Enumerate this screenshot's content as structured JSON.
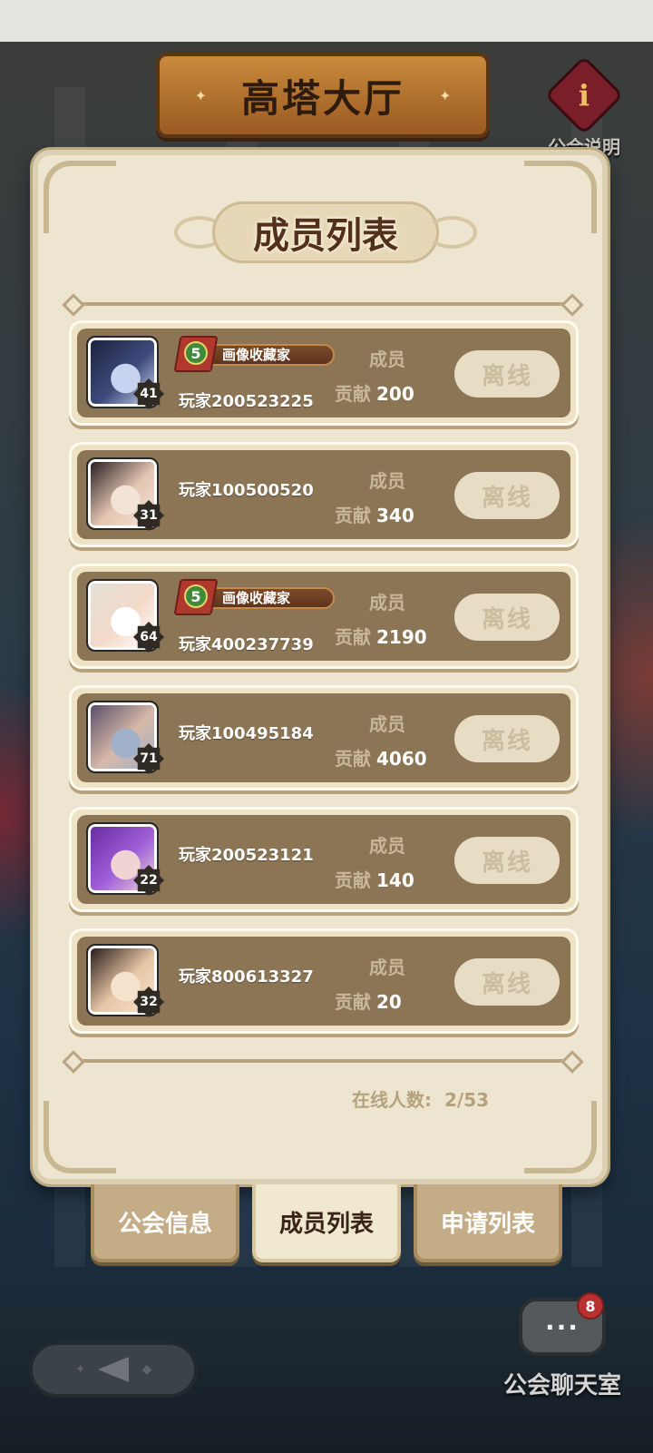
{
  "header": {
    "title": "高塔大厅",
    "guild_info_label": "公会说明",
    "guild_info_icon_glyph": "i"
  },
  "panel": {
    "title": "成员列表",
    "status_label": "离线",
    "members": [
      {
        "name": "玩家200523225",
        "level": "41",
        "role": "成员",
        "contribution_label": "贡献",
        "contribution": "200",
        "title_badge": {
          "rank": "5",
          "text": "画像收藏家"
        },
        "avatar_colors": [
          "#1d2340",
          "#3d4a7a",
          "#c8d4ef"
        ]
      },
      {
        "name": "玩家100500520",
        "level": "31",
        "role": "成员",
        "contribution_label": "贡献",
        "contribution": "340",
        "title_badge": null,
        "avatar_colors": [
          "#2a1f24",
          "#e5c6b2",
          "#f3e3d6"
        ]
      },
      {
        "name": "玩家400237739",
        "level": "64",
        "role": "成员",
        "contribution_label": "贡献",
        "contribution": "2190",
        "title_badge": {
          "rank": "5",
          "text": "画像收藏家"
        },
        "avatar_colors": [
          "#e4e0d8",
          "#f3d9c8",
          "#ffffff"
        ]
      },
      {
        "name": "玩家100495184",
        "level": "71",
        "role": "成员",
        "contribution_label": "贡献",
        "contribution": "4060",
        "title_badge": null,
        "avatar_colors": [
          "#5a4f6a",
          "#d7b9a8",
          "#9fb0c8"
        ]
      },
      {
        "name": "玩家200523121",
        "level": "22",
        "role": "成员",
        "contribution_label": "贡献",
        "contribution": "140",
        "title_badge": null,
        "avatar_colors": [
          "#6a2aa0",
          "#a060d8",
          "#f0d4d4"
        ]
      },
      {
        "name": "玩家800613327",
        "level": "32",
        "role": "成员",
        "contribution_label": "贡献",
        "contribution": "20",
        "title_badge": null,
        "avatar_colors": [
          "#2a1e1a",
          "#e8c6a6",
          "#f5e2cc"
        ]
      }
    ],
    "online_label": "在线人数:",
    "online_value": "2/53"
  },
  "tabs": [
    {
      "label": "公会信息",
      "active": false
    },
    {
      "label": "成员列表",
      "active": true
    },
    {
      "label": "申请列表",
      "active": false
    }
  ],
  "bottom": {
    "chat_label": "公会聊天室",
    "chat_badge": "8",
    "chat_icon_glyph": "···",
    "back_icon": "back-arrow-icon"
  },
  "colors": {
    "panel_bg": "#ede5cf",
    "row_bg": "#8c7554",
    "title_brown": "#53301c",
    "offline_btn": "#e7dcc4"
  }
}
